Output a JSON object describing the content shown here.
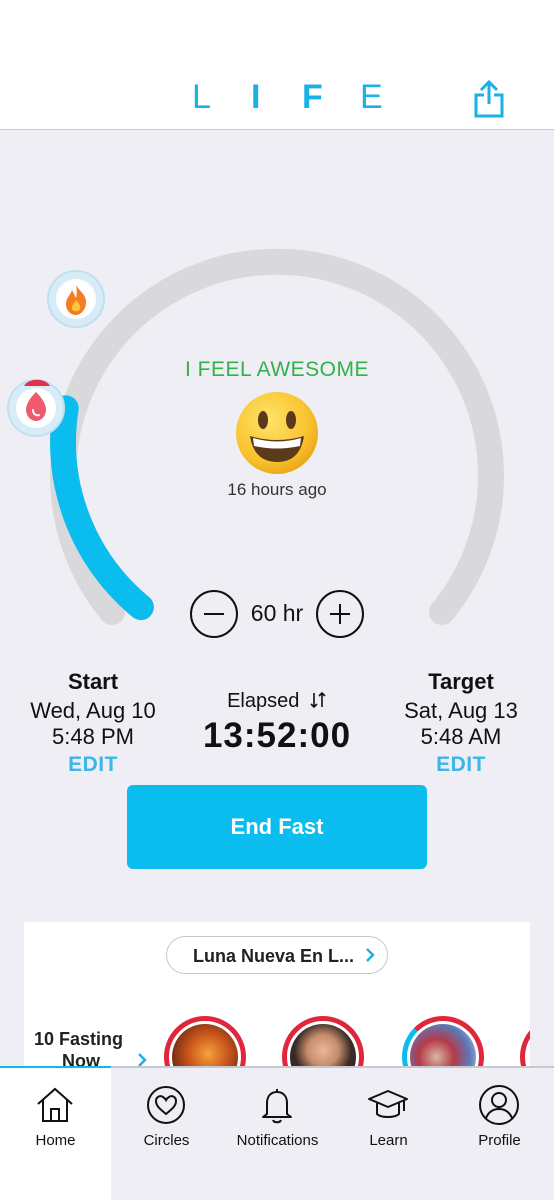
{
  "header": {
    "logo_letters": [
      "L",
      "I",
      "F",
      "E"
    ],
    "share_icon": "share-icon",
    "accent_color": "#1ab1e6"
  },
  "tracker": {
    "progress_fraction": 0.23,
    "track_color": "#d9d9dc",
    "progress_color": "#0bbcef",
    "mood": {
      "label": "I FEEL AWESOME",
      "emoji_icon": "grinning-face-icon",
      "time_ago": "16 hours ago"
    },
    "duration": {
      "value": "60 hr"
    }
  },
  "start": {
    "title": "Start",
    "date": "Wed, Aug 10",
    "time": "5:48 PM",
    "edit_label": "EDIT"
  },
  "elapsed": {
    "label": "Elapsed",
    "toggle_icon": "swap-arrows-icon",
    "value": "13:52:00"
  },
  "target": {
    "title": "Target",
    "date": "Sat, Aug 13",
    "time": "5:48 AM",
    "edit_label": "EDIT"
  },
  "actions": {
    "end_fast_label": "End Fast"
  },
  "circle_card": {
    "circle_name": "Luna Nueva En L...",
    "fasting_now_line1": "10 Fasting",
    "fasting_now_line2": "Now"
  },
  "tabbar": {
    "active": "Home",
    "tabs": [
      {
        "label": "Home",
        "icon": "home-icon"
      },
      {
        "label": "Circles",
        "icon": "heart-circle-icon"
      },
      {
        "label": "Notifications",
        "icon": "bell-icon"
      },
      {
        "label": "Learn",
        "icon": "graduation-cap-icon"
      },
      {
        "label": "Profile",
        "icon": "person-icon"
      }
    ]
  }
}
